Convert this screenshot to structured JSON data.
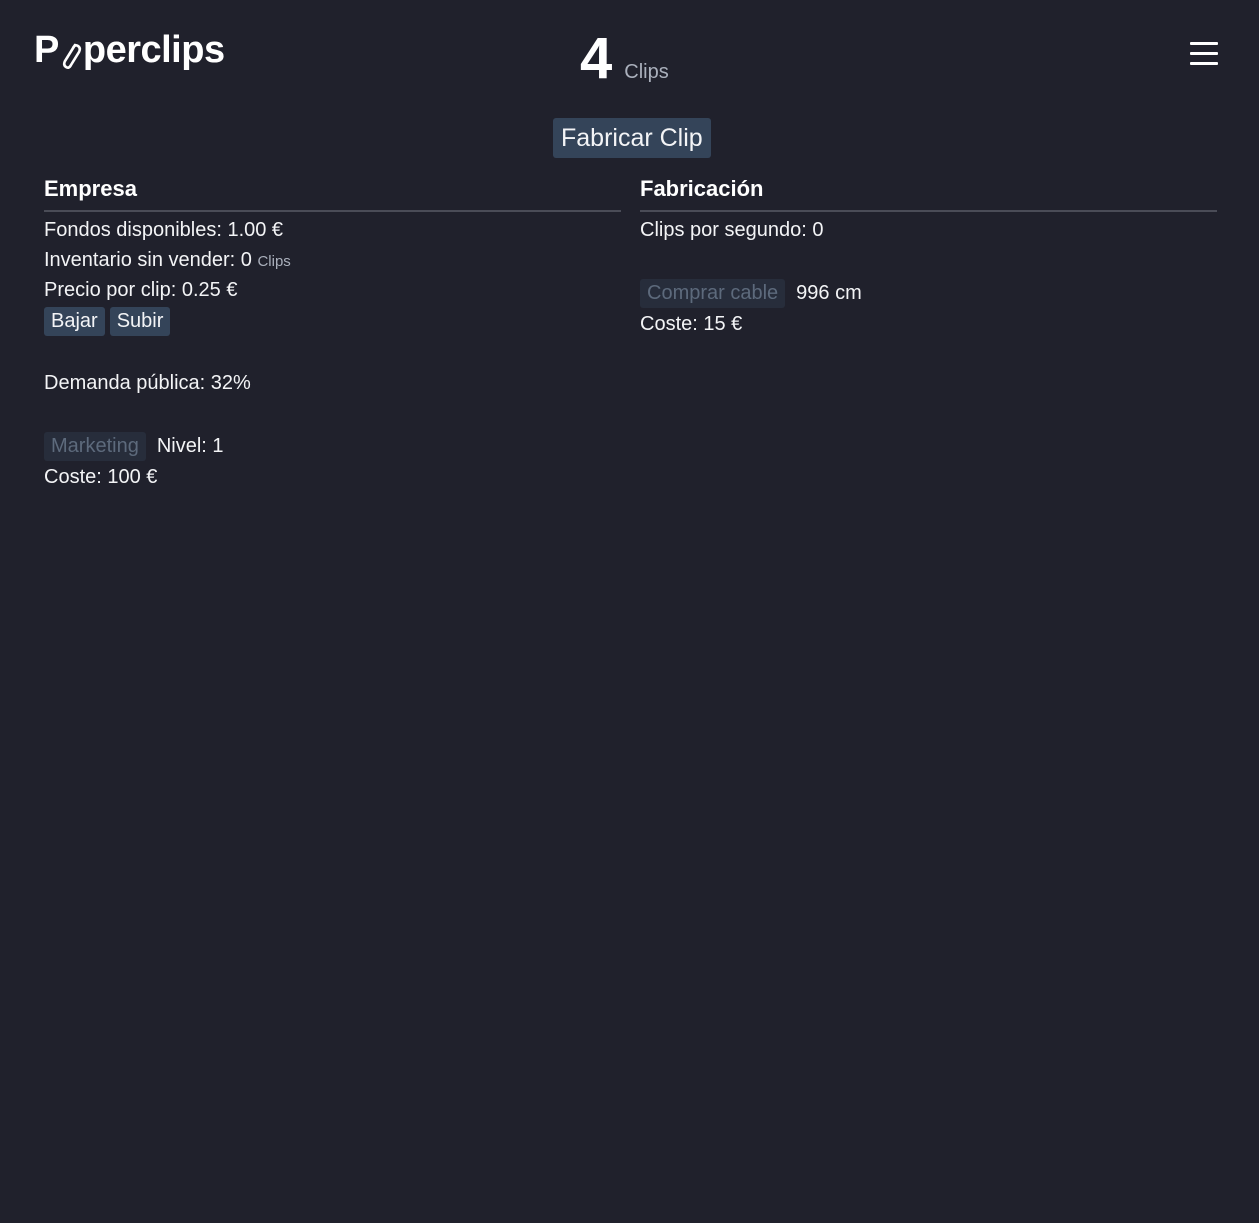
{
  "header": {
    "logo_prefix": "P",
    "logo_suffix": "perclips",
    "clip_count": "4",
    "clip_unit": "Clips"
  },
  "actions": {
    "make_clip_label": "Fabricar Clip"
  },
  "business": {
    "title": "Empresa",
    "funds_label": "Fondos disponibles: 1.00 €",
    "inventory_label": "Inventario sin vender: 0",
    "inventory_unit": "Clips",
    "price_label": "Precio por clip: 0.25 €",
    "lower_label": "Bajar",
    "raise_label": "Subir",
    "demand_label": "Demanda pública: 32%",
    "marketing_label": "Marketing",
    "marketing_level": "Nivel: 1",
    "marketing_cost": "Coste: 100 €"
  },
  "manufacturing": {
    "title": "Fabricación",
    "rate_label": "Clips por segundo: 0",
    "buy_wire_label": "Comprar cable",
    "wire_amount": "996 cm",
    "wire_cost": "Coste: 15 €"
  },
  "colors": {
    "background": "#20212c",
    "button": "#344459",
    "button_disabled": "#272d3b",
    "divider": "#4a4c57"
  },
  "icons": {
    "logo_letter": "paperclip-icon",
    "menu": "hamburger-menu-icon"
  }
}
